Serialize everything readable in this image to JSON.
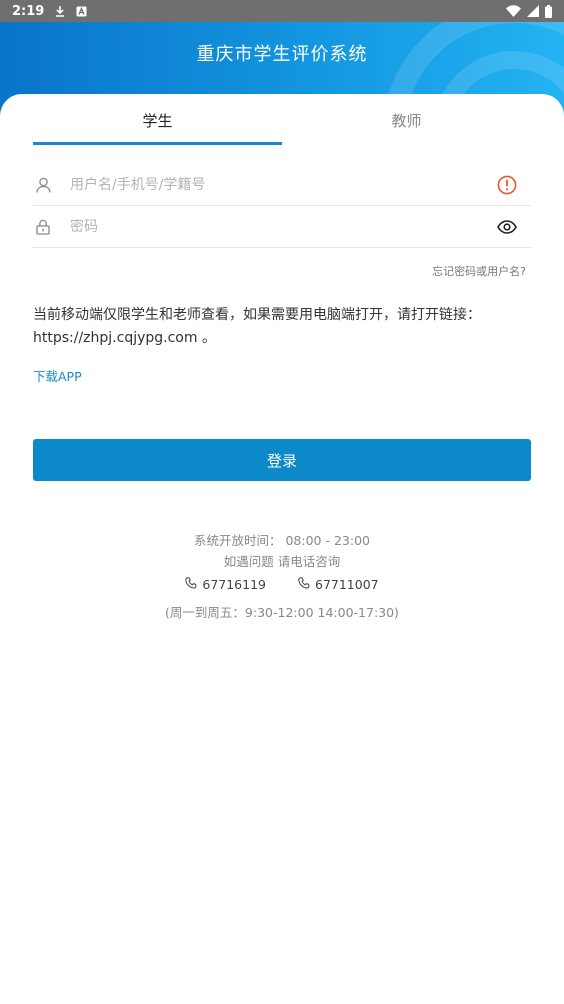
{
  "status_bar": {
    "time": "2:19"
  },
  "header": {
    "title": "重庆市学生评价系统"
  },
  "tabs": [
    {
      "label": "学生",
      "active": true
    },
    {
      "label": "教师",
      "active": false
    }
  ],
  "username_field": {
    "placeholder": "用户名/手机号/学籍号",
    "value": ""
  },
  "password_field": {
    "placeholder": "密码",
    "value": ""
  },
  "forgot_link": "忘记密码或用户名?",
  "notice": {
    "line1": "当前移动端仅限学生和老师查看，如果需要用电脑端打开，请打开链接：",
    "line2": "https://zhpj.cqjypg.com 。"
  },
  "download_link": "下载APP",
  "login_button": "登录",
  "footer": {
    "open_time": "系统开放时间： 08:00 - 23:00",
    "contact": "如遇问题 请电话咨询",
    "phone1": "67716119",
    "phone2": "67711007",
    "hours": "(周一到周五：9:30-12:00 14:00-17:30)"
  },
  "colors": {
    "primary": "#0b89c9",
    "warning": "#e8572a",
    "link": "#1a88d0"
  }
}
